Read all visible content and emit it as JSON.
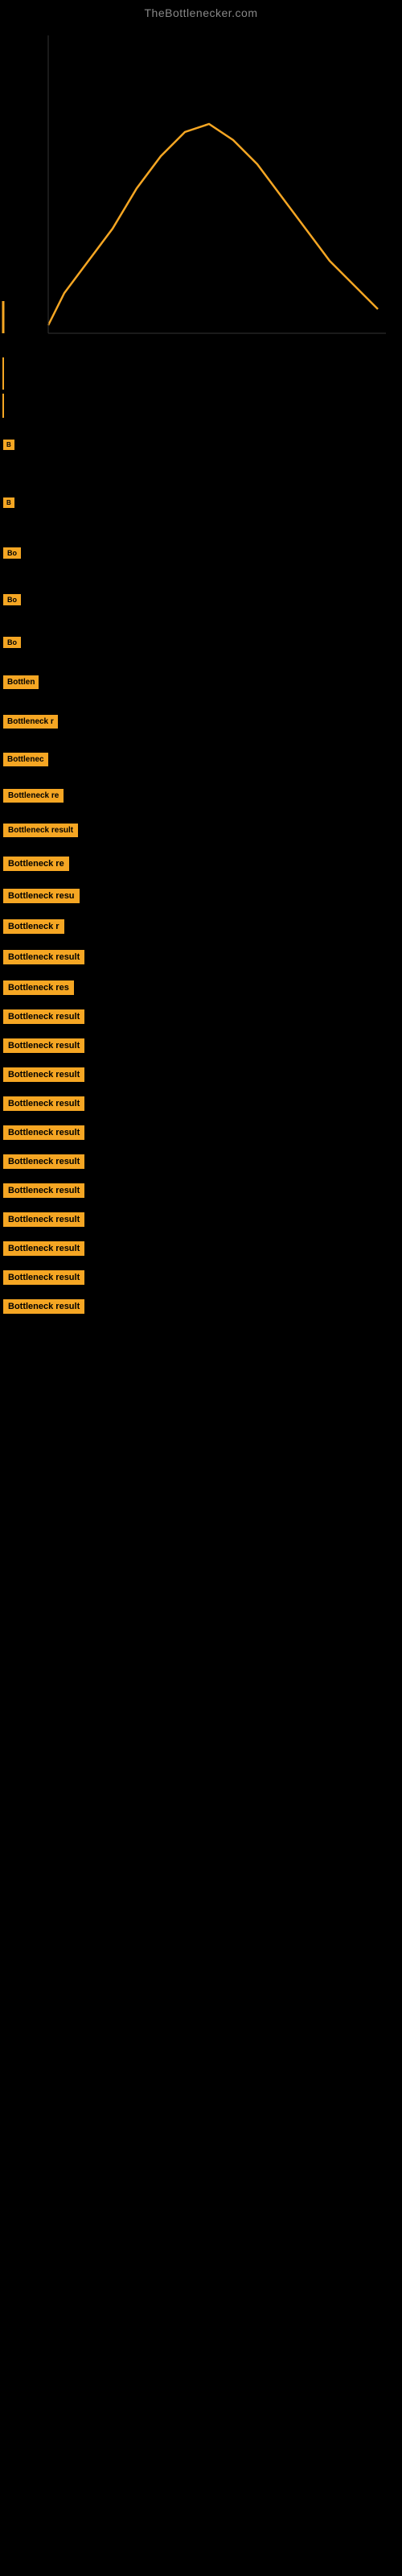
{
  "site": {
    "title": "TheBottlenecker.com"
  },
  "chart": {
    "backgroundColor": "#000000",
    "lineColor": "#F5A623"
  },
  "items": [
    {
      "label": "B",
      "visible_text": "B"
    },
    {
      "label": "B",
      "visible_text": "B"
    },
    {
      "label": "Bo",
      "visible_text": "Bo"
    },
    {
      "label": "Bo",
      "visible_text": "Bo"
    },
    {
      "label": "Bo",
      "visible_text": "Bo"
    },
    {
      "label": "Bottlen",
      "visible_text": "Bottlen"
    },
    {
      "label": "Bottleneck r",
      "visible_text": "Bottleneck r"
    },
    {
      "label": "Bottlenec",
      "visible_text": "Bottlenec"
    },
    {
      "label": "Bottleneck re",
      "visible_text": "Bottleneck re"
    },
    {
      "label": "Bottleneck result",
      "visible_text": "Bottleneck result"
    },
    {
      "label": "Bottleneck re",
      "visible_text": "Bottleneck re"
    },
    {
      "label": "Bottleneck resu",
      "visible_text": "Bottleneck resu"
    },
    {
      "label": "Bottleneck r",
      "visible_text": "Bottleneck r"
    },
    {
      "label": "Bottleneck result",
      "visible_text": "Bottleneck result"
    },
    {
      "label": "Bottleneck res",
      "visible_text": "Bottleneck res"
    },
    {
      "label": "Bottleneck result",
      "visible_text": "Bottleneck result"
    },
    {
      "label": "Bottleneck result",
      "visible_text": "Bottleneck result"
    },
    {
      "label": "Bottleneck result",
      "visible_text": "Bottleneck result"
    },
    {
      "label": "Bottleneck result",
      "visible_text": "Bottleneck result"
    },
    {
      "label": "Bottleneck result",
      "visible_text": "Bottleneck result"
    },
    {
      "label": "Bottleneck result",
      "visible_text": "Bottleneck result"
    },
    {
      "label": "Bottleneck result",
      "visible_text": "Bottleneck result"
    },
    {
      "label": "Bottleneck result",
      "visible_text": "Bottleneck result"
    },
    {
      "label": "Bottleneck result",
      "visible_text": "Bottleneck result"
    },
    {
      "label": "Bottleneck result",
      "visible_text": "Bottleneck result"
    },
    {
      "label": "Bottleneck result",
      "visible_text": "Bottleneck result"
    }
  ]
}
